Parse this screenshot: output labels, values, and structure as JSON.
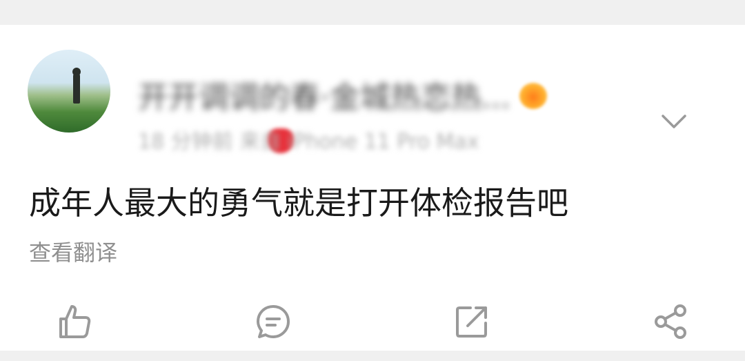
{
  "post": {
    "author_name": "开开调调的春·金城热恋热...",
    "meta": "18 分钟前 来自 iPhone 11 Pro Max",
    "text": "成年人最大的勇气就是打开体检报告吧",
    "translate_label": "查看翻译"
  },
  "icons": {
    "more": "chevron-down-icon",
    "like": "thumbs-up-icon",
    "comment": "comment-icon",
    "repost": "repost-icon",
    "share": "share-icon",
    "badge": "vip-badge-icon",
    "heart": "heart-icon"
  },
  "colors": {
    "icon_gray": "#9a9a9a",
    "text_primary": "#1a1a1a",
    "text_secondary": "#8f8f8f",
    "heart_red": "#e8313b",
    "badge_orange": "#ffa41f"
  }
}
